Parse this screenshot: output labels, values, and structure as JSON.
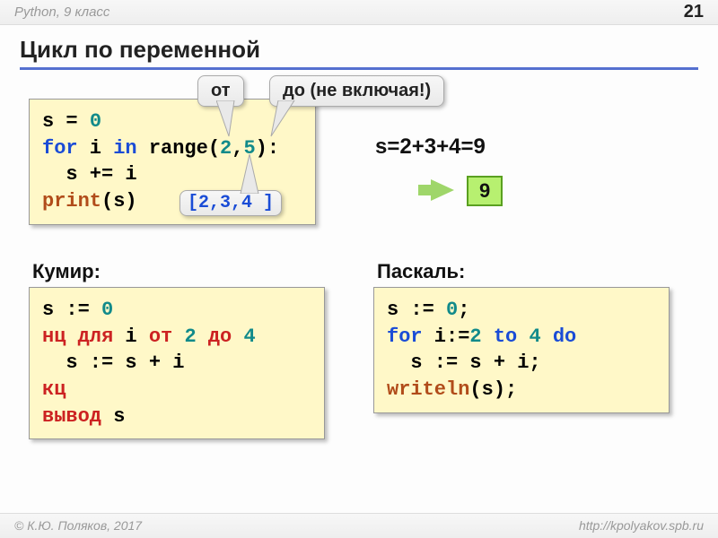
{
  "header": {
    "left": "Python, 9 класс",
    "page": "21"
  },
  "title": "Цикл по переменной",
  "code_python": {
    "l1a": "s = ",
    "l1b": "0",
    "l2a": "for",
    "l2b": " i ",
    "l2c": "in",
    "l2d": " range(",
    "l2e": "2",
    "l2f": ",",
    "l2g": "5",
    "l2h": "):",
    "l3": "  s += i",
    "l4a": "print",
    "l4b": "(s)"
  },
  "callouts": {
    "from": "от",
    "to": "до (не включая!)",
    "range_values": "[2,3,4\n]"
  },
  "sum": {
    "expr": "s=2+3+4=9",
    "result": "9"
  },
  "subheads": {
    "kumir": "Кумир:",
    "pascal": "Паскаль:"
  },
  "code_kumir": {
    "l1a": "s := ",
    "l1b": "0",
    "l2a": "нц для",
    "l2b": " i ",
    "l2c": "от",
    "l2d": " ",
    "l2e": "2",
    "l2f": " ",
    "l2g": "до",
    "l2h": " ",
    "l2i": "4",
    "l3": "  s := s + i",
    "l4": "кц",
    "l5a": "вывод",
    "l5b": " s"
  },
  "code_pascal": {
    "l1a": "s := ",
    "l1b": "0",
    "l1c": ";",
    "l2a": "for",
    "l2b": " i:=",
    "l2c": "2",
    "l2d": " ",
    "l2e": "to",
    "l2f": " ",
    "l2g": "4",
    "l2h": " ",
    "l2i": "do",
    "l3": "  s := s + i;",
    "l4a": "writeln",
    "l4b": "(s);"
  },
  "footer": {
    "left": "© К.Ю. Поляков, 2017",
    "right": "http://kpolyakov.spb.ru"
  }
}
